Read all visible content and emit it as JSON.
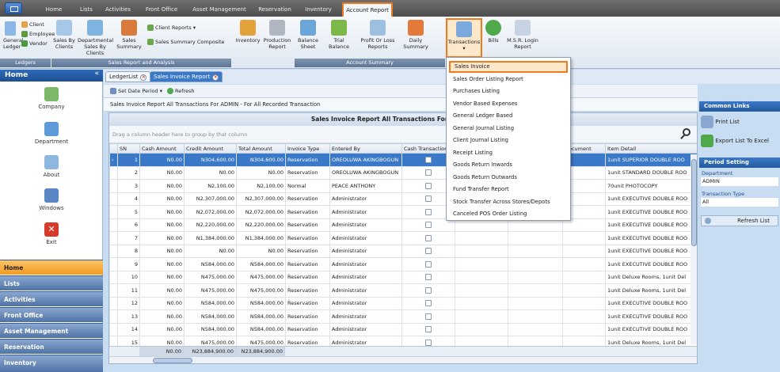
{
  "ribbon_tabs": [
    "Home",
    "Lists",
    "Activities",
    "Front Office",
    "Asset Management",
    "Reservation",
    "Inventory",
    "Account Report"
  ],
  "ribbon": {
    "general_ledger": "General Ledger",
    "client": "Client",
    "employee": "Employee",
    "vendor": "Vendor",
    "ledgers_group": "Ledgers",
    "sales_by_clients": "Sales By Clients",
    "departmental_sales_by_clients": "Departmental Sales By Clients",
    "sales_summary": "Sales Summary",
    "client_reports": "Client Reports",
    "sales_summary_composite": "Sales Summary Composite",
    "sales_group": "Sales Report and Analysis",
    "inventory_report": "Inventory",
    "production_report": "Production Report",
    "balance_sheet": "Balance Sheet",
    "trial_balance": "Trial Balance",
    "profit_or_loss": "Profit Or Loss Reports",
    "daily_summary": "Daily Summary",
    "transactions": "Transactions",
    "bills": "Bills",
    "msr_login_report": "M.S.R. Login Report",
    "account_group": "Account Summary"
  },
  "nav": {
    "title": "Home",
    "collapse": "«",
    "items": [
      "Company",
      "Department",
      "About",
      "Windows",
      "Exit"
    ],
    "bars": [
      "Home",
      "Lists",
      "Activities",
      "Front Office",
      "Asset Management",
      "Reservation",
      "Inventory"
    ]
  },
  "doc_tabs": [
    "LedgerList",
    "Sales Invoice Report"
  ],
  "toolbar": {
    "set_date_period": "Set Date Period",
    "refresh": "Refresh"
  },
  "subtitle": "Sales Invoice Report All Transactions For ADMIN - For All Recorded Transaction",
  "grid": {
    "title": "Sales Invoice Report All Transactions For ADMIN - For A",
    "group_hint": "Drag a column header here to group by that column",
    "columns": [
      "SN",
      "Cash Amount",
      "Credit Amount",
      "Total Amount",
      "Invoice Type",
      "Entered By",
      "Cash Transaction",
      "",
      "",
      "Document",
      "Item Detail"
    ],
    "rows": [
      [
        "1",
        "N0.00",
        "N304,600.00",
        "N304,600.00",
        "Reservation",
        "OREOLUWA AKINGBOGUN",
        "1unit SUPERIOR DOUBLE ROO"
      ],
      [
        "2",
        "N0.00",
        "N0.00",
        "N0.00",
        "Reservation",
        "OREOLUWA AKINGBOGUN",
        "1unit STANDARD DOUBLE ROO"
      ],
      [
        "3",
        "N0.00",
        "N2,100.00",
        "N2,100.00",
        "Normal",
        "PEACE ANTHONY",
        "70unit PHOTOCOPY"
      ],
      [
        "4",
        "N0.00",
        "N2,307,000.00",
        "N2,307,000.00",
        "Reservation",
        "Administrator",
        "1unit EXECUTIVE DOUBLE ROO"
      ],
      [
        "5",
        "N0.00",
        "N2,072,000.00",
        "N2,072,000.00",
        "Reservation",
        "Administrator",
        "1unit EXECUTIVE DOUBLE ROO"
      ],
      [
        "6",
        "N0.00",
        "N2,220,000.00",
        "N2,220,000.00",
        "Reservation",
        "Administrator",
        "1unit EXECUTIVE DOUBLE ROO"
      ],
      [
        "7",
        "N0.00",
        "N1,384,000.00",
        "N1,384,000.00",
        "Reservation",
        "Administrator",
        "1unit EXECUTIVE DOUBLE ROO"
      ],
      [
        "8",
        "N0.00",
        "N0.00",
        "N0.00",
        "Reservation",
        "Administrator",
        "1unit EXECUTIVE DOUBLE ROO"
      ],
      [
        "9",
        "N0.00",
        "N584,000.00",
        "N584,000.00",
        "Reservation",
        "Administrator",
        "1unit EXECUTIVE DOUBLE ROO"
      ],
      [
        "10",
        "N0.00",
        "N475,000.00",
        "N475,000.00",
        "Reservation",
        "Administrator",
        "1unit Deluxe Rooms, 1unit Del"
      ],
      [
        "11",
        "N0.00",
        "N475,000.00",
        "N475,000.00",
        "Reservation",
        "Administrator",
        "1unit Deluxe Rooms, 1unit Del"
      ],
      [
        "12",
        "N0.00",
        "N584,000.00",
        "N584,000.00",
        "Reservation",
        "Administrator",
        "1unit EXECUTIVE DOUBLE ROO"
      ],
      [
        "13",
        "N0.00",
        "N584,000.00",
        "N584,000.00",
        "Reservation",
        "Administrator",
        "1unit EXECUTIVE DOUBLE ROO"
      ],
      [
        "14",
        "N0.00",
        "N584,000.00",
        "N584,000.00",
        "Reservation",
        "Administrator",
        "1unit EXECUTIVE DOUBLE ROO"
      ],
      [
        "15",
        "N0.00",
        "N475,000.00",
        "N475,000.00",
        "Reservation",
        "Administrator",
        "1unit Deluxe Rooms, 1unit Del"
      ]
    ],
    "totals": {
      "cash": "N0.00",
      "credit": "N23,884,900.00",
      "total": "N23,884,900.00"
    }
  },
  "dropdown": [
    "Sales Invoice",
    "Sales Order Listing Report",
    "Purchases Listing",
    "Vendor Based Expenses",
    "General Ledger Based",
    "General Journal Listing",
    "Client Journal Listing",
    "Receipt Listing",
    "Goods Return Inwards",
    "Goods Return Outwards",
    "Fund Transfer Report",
    "Stock Transfer Across Stores/Depots",
    "Canceled POS Order Listing"
  ],
  "right_panel": {
    "common_links": "Common Links",
    "print_list": "Print List",
    "export_list": "Export List To Excel",
    "period_setting": "Period Setting",
    "department_label": "Department",
    "department_value": "ADMIN",
    "transaction_type_label": "Transaction Type",
    "transaction_type_value": "All",
    "refresh_list": "Refresh List"
  },
  "colors": {
    "accent": "#f07a1e",
    "selection": "#3a78c8",
    "nav_active": "#f39a1e"
  }
}
